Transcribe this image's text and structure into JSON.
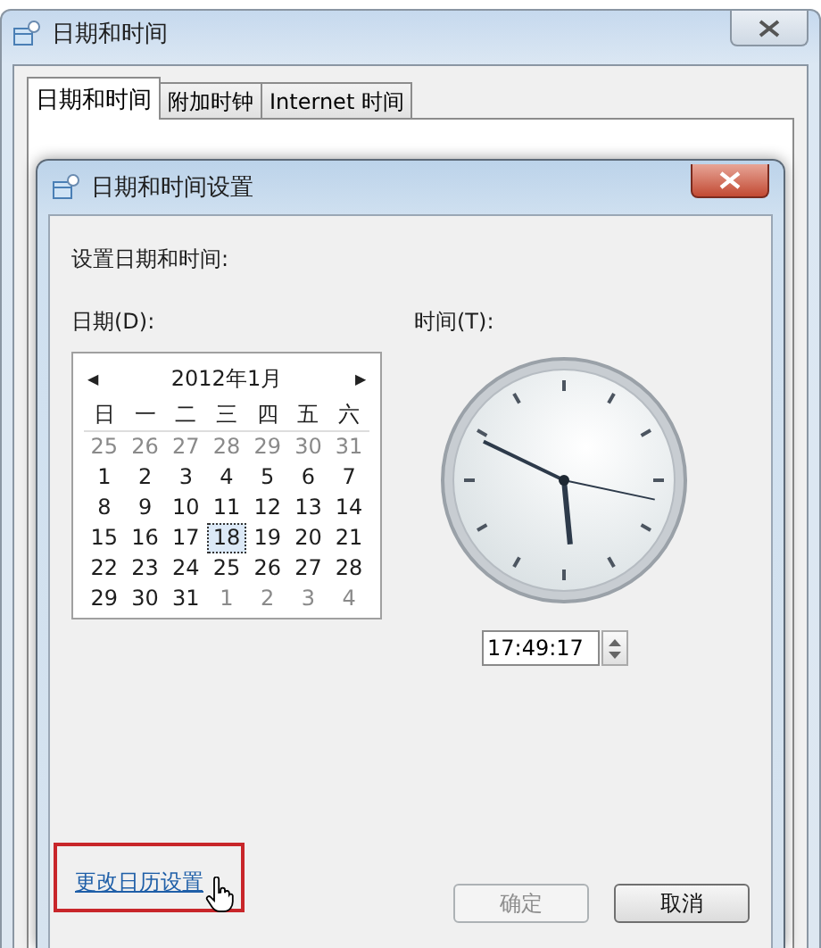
{
  "window": {
    "title": "日期和时间"
  },
  "tabs": [
    {
      "label": "日期和时间",
      "selected": true
    },
    {
      "label": "附加时钟",
      "selected": false
    },
    {
      "label": "Internet 时间",
      "selected": false
    }
  ],
  "dialog": {
    "title": "日期和时间设置",
    "heading": "设置日期和时间:",
    "date_label": "日期(D):",
    "time_label": "时间(T):",
    "calendar": {
      "month": "2012年1月",
      "prev": "◀",
      "next": "▶",
      "weekdays": [
        "日",
        "一",
        "二",
        "三",
        "四",
        "五",
        "六"
      ],
      "weeks": [
        [
          {
            "day": "25",
            "other_month": true,
            "selected": false
          },
          {
            "day": "26",
            "other_month": true,
            "selected": false
          },
          {
            "day": "27",
            "other_month": true,
            "selected": false
          },
          {
            "day": "28",
            "other_month": true,
            "selected": false
          },
          {
            "day": "29",
            "other_month": true,
            "selected": false
          },
          {
            "day": "30",
            "other_month": true,
            "selected": false
          },
          {
            "day": "31",
            "other_month": true,
            "selected": false
          }
        ],
        [
          {
            "day": "1",
            "other_month": false,
            "selected": false
          },
          {
            "day": "2",
            "other_month": false,
            "selected": false
          },
          {
            "day": "3",
            "other_month": false,
            "selected": false
          },
          {
            "day": "4",
            "other_month": false,
            "selected": false
          },
          {
            "day": "5",
            "other_month": false,
            "selected": false
          },
          {
            "day": "6",
            "other_month": false,
            "selected": false
          },
          {
            "day": "7",
            "other_month": false,
            "selected": false
          }
        ],
        [
          {
            "day": "8",
            "other_month": false,
            "selected": false
          },
          {
            "day": "9",
            "other_month": false,
            "selected": false
          },
          {
            "day": "10",
            "other_month": false,
            "selected": false
          },
          {
            "day": "11",
            "other_month": false,
            "selected": false
          },
          {
            "day": "12",
            "other_month": false,
            "selected": false
          },
          {
            "day": "13",
            "other_month": false,
            "selected": false
          },
          {
            "day": "14",
            "other_month": false,
            "selected": false
          }
        ],
        [
          {
            "day": "15",
            "other_month": false,
            "selected": false
          },
          {
            "day": "16",
            "other_month": false,
            "selected": false
          },
          {
            "day": "17",
            "other_month": false,
            "selected": false
          },
          {
            "day": "18",
            "other_month": false,
            "selected": true
          },
          {
            "day": "19",
            "other_month": false,
            "selected": false
          },
          {
            "day": "20",
            "other_month": false,
            "selected": false
          },
          {
            "day": "21",
            "other_month": false,
            "selected": false
          }
        ],
        [
          {
            "day": "22",
            "other_month": false,
            "selected": false
          },
          {
            "day": "23",
            "other_month": false,
            "selected": false
          },
          {
            "day": "24",
            "other_month": false,
            "selected": false
          },
          {
            "day": "25",
            "other_month": false,
            "selected": false
          },
          {
            "day": "26",
            "other_month": false,
            "selected": false
          },
          {
            "day": "27",
            "other_month": false,
            "selected": false
          },
          {
            "day": "28",
            "other_month": false,
            "selected": false
          }
        ],
        [
          {
            "day": "29",
            "other_month": false,
            "selected": false
          },
          {
            "day": "30",
            "other_month": false,
            "selected": false
          },
          {
            "day": "31",
            "other_month": false,
            "selected": false
          },
          {
            "day": "1",
            "other_month": true,
            "selected": false
          },
          {
            "day": "2",
            "other_month": true,
            "selected": false
          },
          {
            "day": "3",
            "other_month": true,
            "selected": false
          },
          {
            "day": "4",
            "other_month": true,
            "selected": false
          }
        ]
      ]
    },
    "time": "17:49:17",
    "link": {
      "label": "更改日历设置",
      "highlighted": true
    },
    "buttons": [
      {
        "label": "确定",
        "disabled": true
      },
      {
        "label": "取消",
        "disabled": false
      }
    ]
  }
}
